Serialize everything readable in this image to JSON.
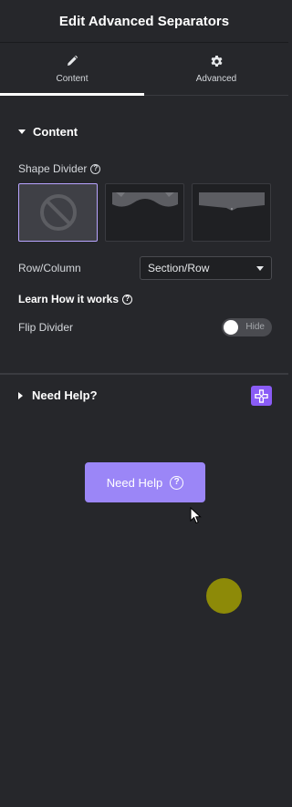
{
  "header": {
    "title": "Edit Advanced Separators"
  },
  "tabs": [
    {
      "label": "Content",
      "icon": "pencil-icon",
      "active": true
    },
    {
      "label": "Advanced",
      "icon": "gear-icon",
      "active": false
    }
  ],
  "content_section": {
    "title": "Content",
    "shape_divider": {
      "label": "Shape Divider",
      "options": [
        {
          "name": "none",
          "icon": "prohibited-icon",
          "selected": true
        },
        {
          "name": "curves",
          "icon": "curves-shape-icon",
          "selected": false
        },
        {
          "name": "notch",
          "icon": "notch-shape-icon",
          "selected": false
        }
      ]
    },
    "row_column": {
      "label": "Row/Column",
      "value": "Section/Row"
    },
    "learn_link": "Learn How it works",
    "flip_divider": {
      "label": "Flip Divider",
      "toggle_text": "Hide",
      "enabled": false
    }
  },
  "help_section": {
    "title": "Need Help?",
    "badge_icon": "plugin-logo-icon",
    "button_label": "Need Help"
  },
  "colors": {
    "background": "#26272b",
    "accent": "#9b86f7",
    "badge": "#8a5cf6",
    "indicator_dot": "#8d8a08"
  }
}
